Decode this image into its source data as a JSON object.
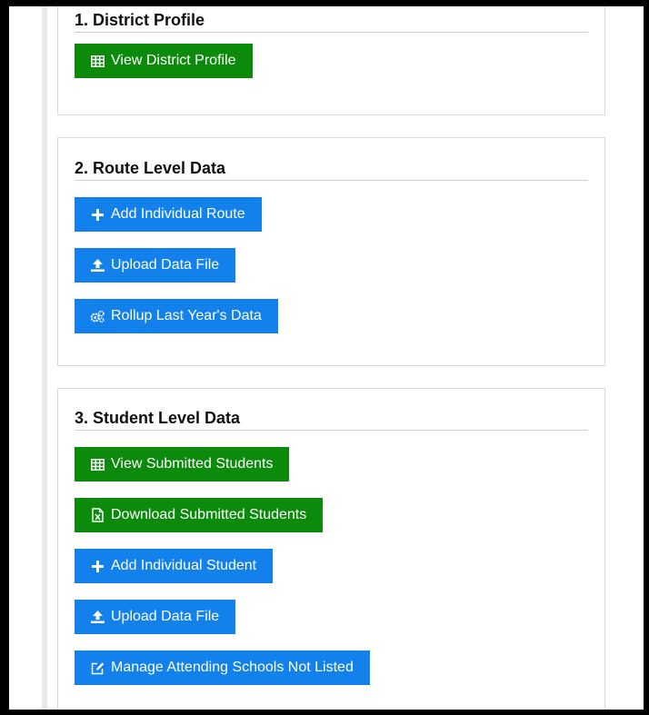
{
  "sections": [
    {
      "title": "1. District Profile",
      "buttons": [
        {
          "label": "View District Profile",
          "icon": "table-icon",
          "color": "#0c8a0c"
        }
      ]
    },
    {
      "title": "2. Route Level Data",
      "buttons": [
        {
          "label": "Add Individual Route",
          "icon": "plus-icon",
          "color": "#1381ec"
        },
        {
          "label": "Upload Data File",
          "icon": "upload-icon",
          "color": "#1381ec"
        },
        {
          "label": "Rollup Last Year's Data",
          "icon": "gears-icon",
          "color": "#1381ec"
        }
      ]
    },
    {
      "title": "3. Student Level Data",
      "buttons": [
        {
          "label": "View Submitted Students",
          "icon": "table-icon",
          "color": "#0c8a0c"
        },
        {
          "label": "Download Submitted Students",
          "icon": "excel-file-icon",
          "color": "#0c8a0c"
        },
        {
          "label": "Add Individual Student",
          "icon": "plus-icon",
          "color": "#1381ec"
        },
        {
          "label": "Upload Data File",
          "icon": "upload-icon",
          "color": "#1381ec"
        },
        {
          "label": "Manage Attending Schools Not Listed",
          "icon": "edit-icon",
          "color": "#1381ec"
        }
      ]
    }
  ]
}
